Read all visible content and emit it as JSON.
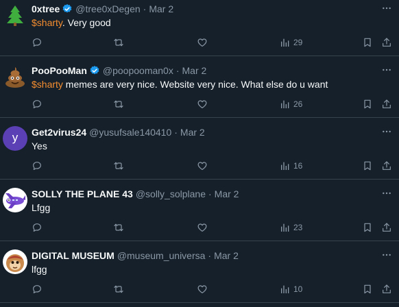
{
  "tweets": [
    {
      "name": "0xtree",
      "verified": true,
      "handle": "@tree0xDegen",
      "dot": "·",
      "date": "Mar 2",
      "cashtag": "$sharty",
      "text": ". Very good",
      "views": "29",
      "avatar_icon": "tree-icon"
    },
    {
      "name": "PooPooMan",
      "verified": true,
      "handle": "@poopooman0x",
      "dot": "·",
      "date": "Mar 2",
      "cashtag": "$sharty",
      "text": " memes are very nice. Website very nice. What else do u want",
      "views": "26",
      "avatar_icon": "poop-icon"
    },
    {
      "name": "Get2virus24",
      "verified": false,
      "handle": "@yusufsale140410",
      "dot": "·",
      "date": "Mar 2",
      "cashtag": "",
      "text": "Yes",
      "views": "16",
      "avatar_letter": "y"
    },
    {
      "name": "SOLLY THE PLANE 43",
      "verified": false,
      "handle": "@solly_solplane",
      "dot": "·",
      "date": "Mar 2",
      "cashtag": "",
      "text": "Lfgg",
      "views": "23",
      "avatar_icon": "plane-icon"
    },
    {
      "name": "DIGITAL MUSEUM",
      "verified": false,
      "handle": "@museum_universa",
      "dot": "·",
      "date": "Mar 2",
      "cashtag": "",
      "text": "lfgg",
      "views": "10",
      "avatar_icon": "monkey-icon"
    }
  ],
  "colors": {
    "background": "#15202b",
    "divider": "#38444d",
    "muted": "#8b98a5",
    "cashtag": "#f68e2f",
    "verified": "#1d9bf0"
  }
}
